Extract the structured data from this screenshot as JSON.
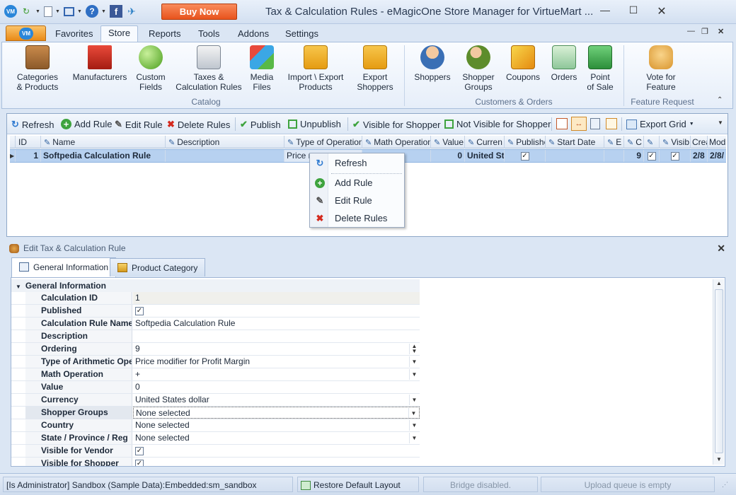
{
  "titlebar": {
    "buy_now": "Buy Now",
    "title": "Tax & Calculation Rules - eMagicOne Store Manager for VirtueMart ...",
    "minimize": "—",
    "restore": "☐",
    "close": "✕"
  },
  "ribbon_tabs": [
    "Favorites",
    "Store",
    "Reports",
    "Tools",
    "Addons",
    "Settings"
  ],
  "ribbon_tab_active": "Store",
  "ribbon": {
    "catalog": {
      "label": "Catalog",
      "buttons": [
        {
          "l1": "Categories",
          "l2": "& Products"
        },
        {
          "l1": "Manufacturers",
          "l2": ""
        },
        {
          "l1": "Custom",
          "l2": "Fields"
        },
        {
          "l1": "Taxes &",
          "l2": "Calculation Rules"
        },
        {
          "l1": "Media",
          "l2": "Files"
        },
        {
          "l1": "Import \\ Export",
          "l2": "Products"
        },
        {
          "l1": "Export",
          "l2": "Shoppers"
        }
      ]
    },
    "customers": {
      "label": "Customers & Orders",
      "buttons": [
        {
          "l1": "Shoppers",
          "l2": ""
        },
        {
          "l1": "Shopper",
          "l2": "Groups"
        },
        {
          "l1": "Coupons",
          "l2": ""
        },
        {
          "l1": "Orders",
          "l2": ""
        },
        {
          "l1": "Point",
          "l2": "of Sale"
        }
      ]
    },
    "feature": {
      "label": "Feature Request",
      "buttons": [
        {
          "l1": "Vote for",
          "l2": "Feature"
        }
      ]
    }
  },
  "grid_toolbar": {
    "refresh": "Refresh",
    "add_rule": "Add Rule",
    "edit_rule": "Edit Rule",
    "delete_rules": "Delete Rules",
    "publish": "Publish",
    "unpublish": "Unpublish",
    "visible": "Visible for Shopper",
    "not_visible": "Not Visible for Shopper",
    "export_grid": "Export Grid"
  },
  "grid": {
    "columns": [
      "ID",
      "Name",
      "Description",
      "Type of Operation",
      "Math Operation",
      "Value",
      "Curren",
      "Publishe",
      "Start Date",
      "E",
      "C",
      "",
      "Visib",
      "Crea",
      "Modif"
    ],
    "row": {
      "id": "1",
      "name": "Softpedia Calculation Rule",
      "description": "",
      "type": "Price mo",
      "math": "",
      "value": "0",
      "currency": "United St",
      "published": "✓",
      "start_date": "",
      "e": "",
      "c": "9",
      "chk1": "✓",
      "visible": "✓",
      "created": "2/8",
      "modified": "2/8/"
    }
  },
  "context_menu": {
    "refresh": "Refresh",
    "add_rule": "Add Rule",
    "edit_rule": "Edit Rule",
    "delete_rules": "Delete Rules"
  },
  "edit_panel": {
    "title": "Edit Tax & Calculation Rule",
    "close": "✕",
    "tabs": [
      "General Information",
      "Product Category"
    ],
    "category": "General Information",
    "properties": [
      {
        "label": "Calculation ID",
        "value": "1"
      },
      {
        "label": "Published",
        "value": "✓"
      },
      {
        "label": "Calculation Rule Name",
        "value": "Softpedia Calculation Rule"
      },
      {
        "label": "Description",
        "value": ""
      },
      {
        "label": "Ordering",
        "value": "9"
      },
      {
        "label": "Type of Arithmetic Ope",
        "value": "Price modifier for Profit Margin"
      },
      {
        "label": "Math Operation",
        "value": "+"
      },
      {
        "label": "Value",
        "value": "0"
      },
      {
        "label": "Currency",
        "value": "United States dollar"
      },
      {
        "label": "Shopper Groups",
        "value": "None selected"
      },
      {
        "label": "Country",
        "value": "None selected"
      },
      {
        "label": "State / Province / Reg",
        "value": "None selected"
      },
      {
        "label": "Visible for Vendor",
        "value": "✓"
      },
      {
        "label": "Visible for Shopper",
        "value": "✓"
      }
    ]
  },
  "statusbar": {
    "user": "[Is Administrator] Sandbox (Sample Data):Embedded:sm_sandbox",
    "restore_layout": "Restore Default Layout",
    "bridge": "Bridge disabled.",
    "upload": "Upload queue is empty"
  }
}
